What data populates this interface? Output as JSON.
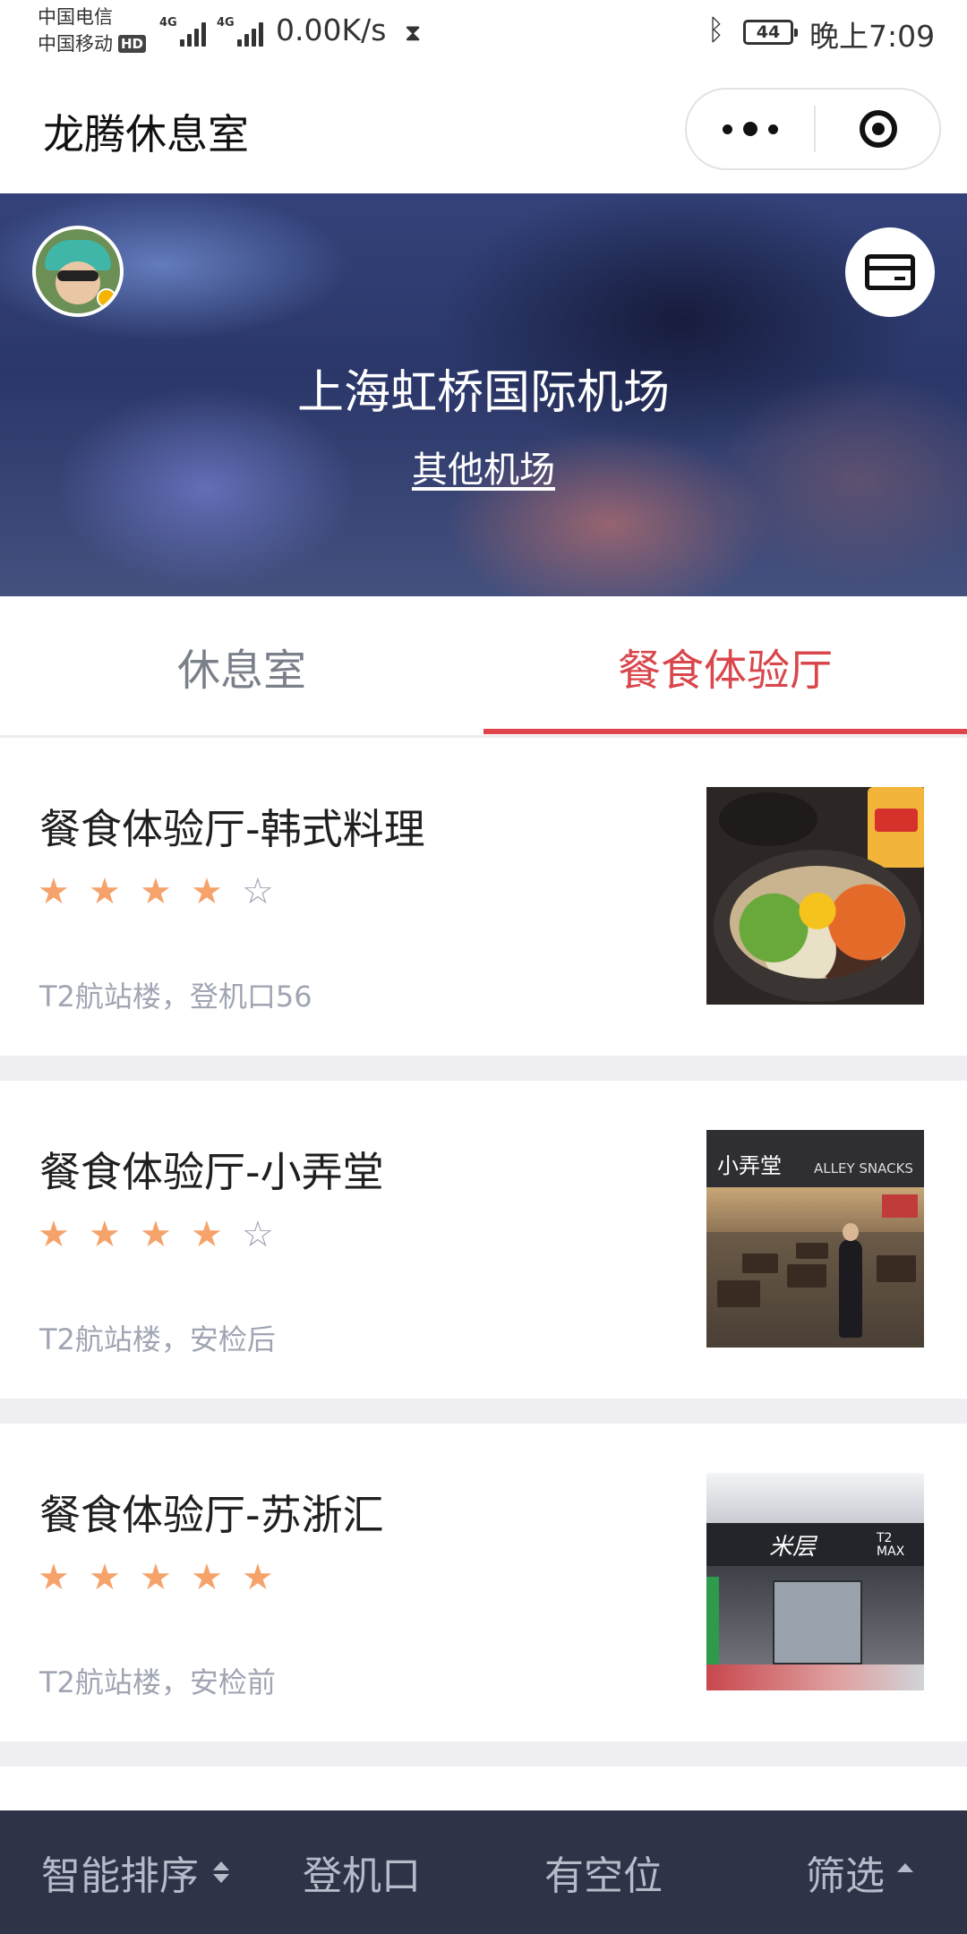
{
  "status_bar": {
    "carrier_1": "中国电信",
    "carrier_2": "中国移动",
    "hd": "HD",
    "network_1": "4G",
    "network_2": "4G",
    "net_speed": "0.00K/s",
    "battery": "44",
    "time": "晚上7:09"
  },
  "nav": {
    "title": "龙腾休息室"
  },
  "hero": {
    "airport": "上海虹桥国际机场",
    "other_airports": "其他机场"
  },
  "tabs": [
    {
      "label": "休息室",
      "active": false
    },
    {
      "label": "餐食体验厅",
      "active": true
    }
  ],
  "colors": {
    "accent": "#e0454b",
    "star": "#f5a26b",
    "bottom_bar": "#2f3348"
  },
  "venues": [
    {
      "title": "餐食体验厅-韩式料理",
      "rating": 4,
      "max_rating": 5,
      "location": "T2航站楼，登机口56",
      "thumbnail": "bibimbap-photo"
    },
    {
      "title": "餐食体验厅-小弄堂",
      "rating": 4,
      "max_rating": 5,
      "location": "T2航站楼，安检后",
      "thumbnail": "restaurant-interior-photo",
      "thumb_sign": "小弄堂",
      "thumb_sign_en": "ALLEY SNACKS"
    },
    {
      "title": "餐食体验厅-苏浙汇",
      "rating": 5,
      "max_rating": 5,
      "location": "T2航站楼，安检前",
      "thumbnail": "restaurant-entrance-photo",
      "thumb_sign": "米层",
      "thumb_sign_en": "T2 MAX"
    }
  ],
  "bottom_bar": {
    "sort": "智能排序",
    "gate": "登机口",
    "vacancy": "有空位",
    "filter": "筛选"
  }
}
